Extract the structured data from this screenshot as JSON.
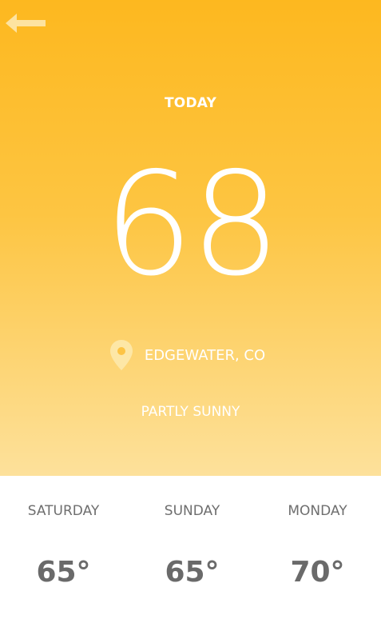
{
  "header": {
    "back_icon": "arrow-left-icon",
    "title": "TODAY"
  },
  "current": {
    "temperature": "68",
    "location_icon": "map-pin-icon",
    "location": "EDGEWATER, CO",
    "condition": "PARTLY SUNNY"
  },
  "forecast": [
    {
      "day": "SATURDAY",
      "temp": "65°"
    },
    {
      "day": "SUNDAY",
      "temp": "65°"
    },
    {
      "day": "MONDAY",
      "temp": "70°"
    }
  ],
  "colors": {
    "gradient_top": "#fdb81f",
    "gradient_bottom": "#fde19b",
    "icon_tint": "#fde7a6",
    "forecast_text": "#6e6e6e"
  }
}
